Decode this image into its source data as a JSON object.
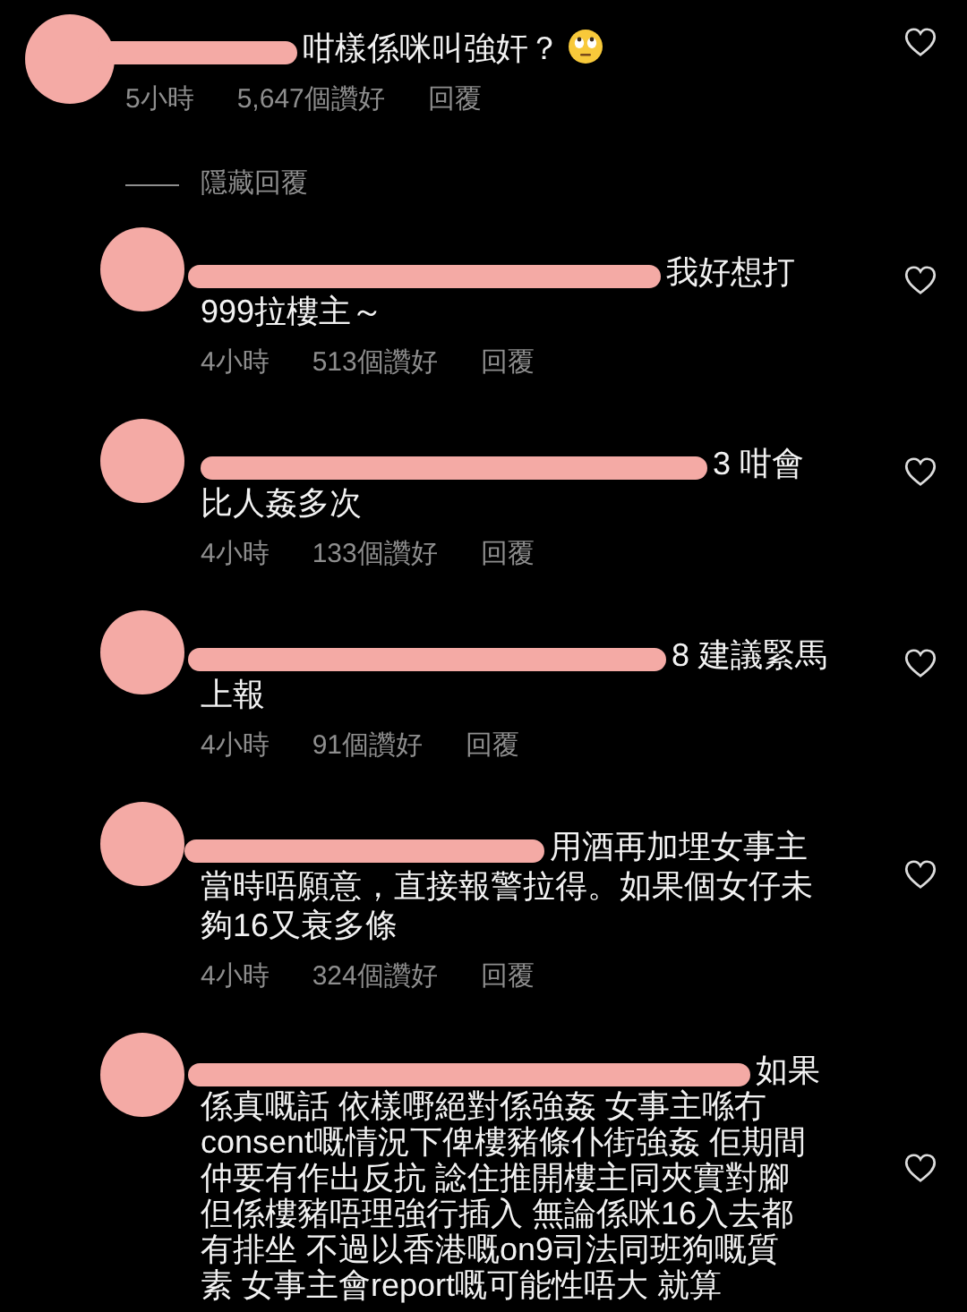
{
  "comment": {
    "lines": [
      "咁樣係咪叫強奸？"
    ],
    "time": "5小時",
    "likes": "5,647個讚好",
    "reply": "回覆",
    "liked": false
  },
  "hide_replies": "隱藏回覆",
  "replies": [
    {
      "lines": [
        "我好想打",
        "999拉樓主～"
      ],
      "time": "4小時",
      "likes": "513個讚好",
      "reply": "回覆",
      "liked": false
    },
    {
      "lines": [
        "3 咁會",
        "比人姦多次"
      ],
      "time": "4小時",
      "likes": "133個讚好",
      "reply": "回覆",
      "liked": false
    },
    {
      "lines": [
        "8 建議緊馬",
        "上報"
      ],
      "time": "4小時",
      "likes": "91個讚好",
      "reply": "回覆",
      "liked": false
    },
    {
      "lines": [
        "用酒再加埋女事主",
        "當時唔願意，直接報警拉得。如果個女仔未",
        "夠16又衰多條"
      ],
      "time": "4小時",
      "likes": "324個讚好",
      "reply": "回覆",
      "liked": false
    },
    {
      "lines": [
        "如果",
        "係真嘅話 依樣嘢絕對係強姦 女事主喺冇",
        "consent嘅情況下俾樓豬條仆街強姦 佢期間",
        "仲要有作出反抗 諗住推開樓主同夾實對腳",
        "但係樓豬唔理強行插入 無論係咪16入去都",
        "有排坐 不過以香港嘅on9司法同班狗嘅質",
        "素 女事主會report嘅可能性唔大 就算"
      ],
      "liked": false
    }
  ]
}
